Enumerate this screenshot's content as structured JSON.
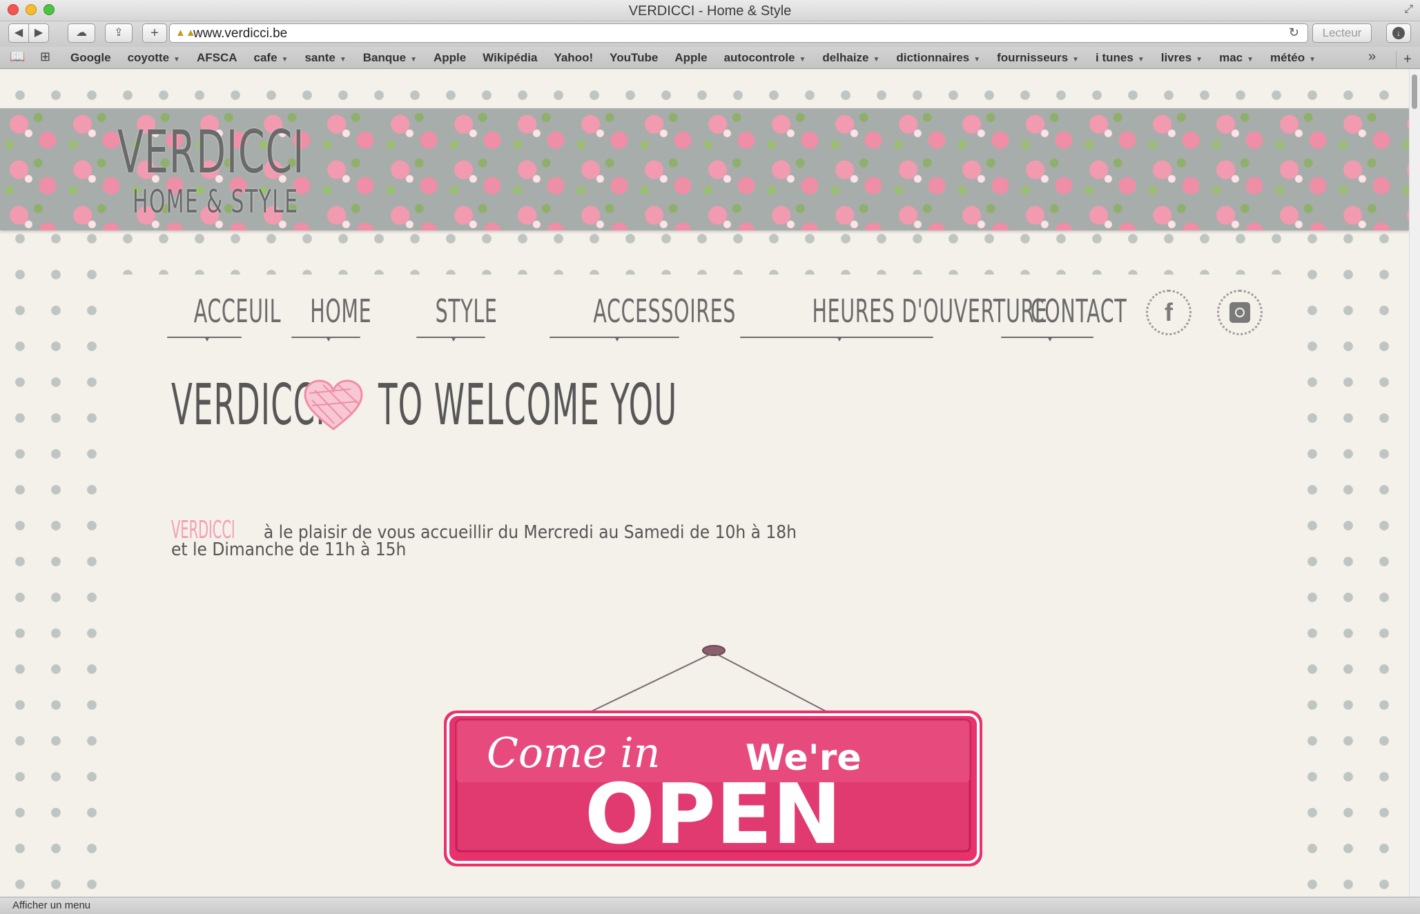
{
  "window": {
    "title": "VERDICCI - Home & Style"
  },
  "toolbar": {
    "url": "www.verdicci.be",
    "reader_label": "Lecteur"
  },
  "bookmarks": [
    {
      "label": "Google",
      "dropdown": false
    },
    {
      "label": "coyotte",
      "dropdown": true
    },
    {
      "label": "AFSCA",
      "dropdown": false
    },
    {
      "label": "cafe",
      "dropdown": true
    },
    {
      "label": "sante",
      "dropdown": true
    },
    {
      "label": "Banque",
      "dropdown": true
    },
    {
      "label": "Apple",
      "dropdown": false
    },
    {
      "label": "Wikipédia",
      "dropdown": false
    },
    {
      "label": "Yahoo!",
      "dropdown": false
    },
    {
      "label": "YouTube",
      "dropdown": false
    },
    {
      "label": "Apple",
      "dropdown": false
    },
    {
      "label": "autocontrole",
      "dropdown": true
    },
    {
      "label": "delhaize",
      "dropdown": true
    },
    {
      "label": "dictionnaires",
      "dropdown": true
    },
    {
      "label": "fournisseurs",
      "dropdown": true
    },
    {
      "label": "i tunes",
      "dropdown": true
    },
    {
      "label": "livres",
      "dropdown": true
    },
    {
      "label": "mac",
      "dropdown": true
    },
    {
      "label": "météo",
      "dropdown": true
    }
  ],
  "site": {
    "logo_main": "VERDICCI",
    "logo_sub": "HOME & STYLE",
    "nav": [
      "ACCEUIL",
      "HOME",
      "STYLE",
      "ACCESSOIRES",
      "HEURES D'OUVERTURE",
      "CONTACT"
    ],
    "social": [
      "facebook-icon",
      "instagram-icon"
    ],
    "welcome_left": "VERDICCI",
    "welcome_right": "TO WELCOME YOU",
    "info_brand": "VERDICCI",
    "info_line1": "à le plaisir de vous accueillir du Mercredi au Samedi de 10h à 18h",
    "info_line2": "et  le Dimanche de 11h à 15h",
    "sign_line1a": "Come in",
    "sign_line1b": "We're",
    "sign_line2": "OPEN"
  },
  "colors": {
    "accent_pink": "#e8336f",
    "text_grey": "#575757",
    "brand_pink": "#f3a0b6"
  },
  "statusbar": {
    "text": "Afficher un menu"
  }
}
